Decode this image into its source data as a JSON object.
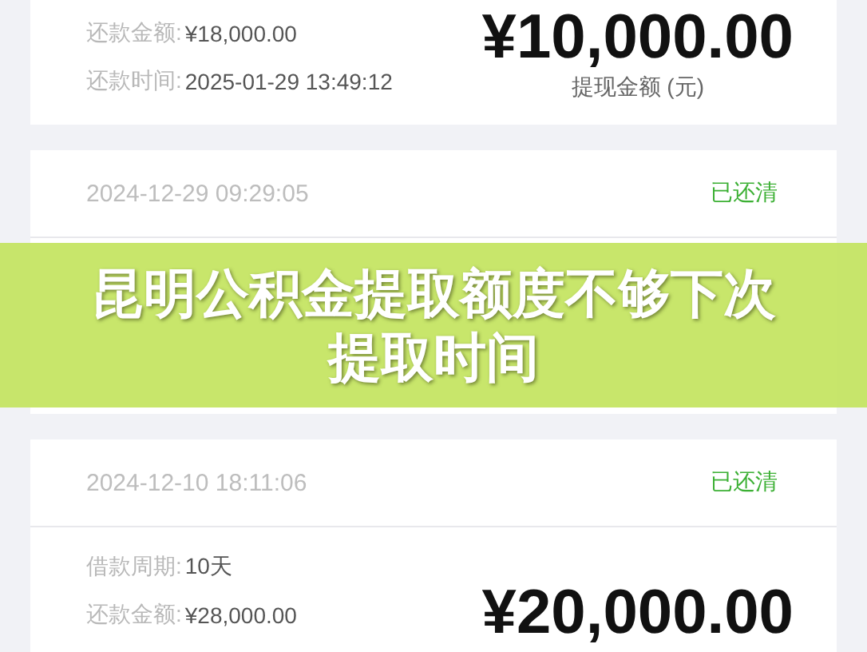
{
  "records": [
    {
      "rows": [
        {
          "label": "还款金额:",
          "value": "¥18,000.00"
        },
        {
          "label": "还款时间:",
          "value": "2025-01-29 13:49:12"
        }
      ],
      "amount": "¥10,000.00",
      "amount_label": "提现金额 (元)"
    },
    {
      "date": "2024-12-29 09:29:05",
      "status": "已还清"
    },
    {
      "date": "2024-12-10 18:11:06",
      "status": "已还清",
      "rows": [
        {
          "label": "借款周期:",
          "value": "10天"
        },
        {
          "label": "还款金额:",
          "value": "¥28,000.00"
        }
      ],
      "amount": "¥20,000.00"
    }
  ],
  "banner": {
    "title": "昆明公积金提取额度不够下次提取时间"
  }
}
